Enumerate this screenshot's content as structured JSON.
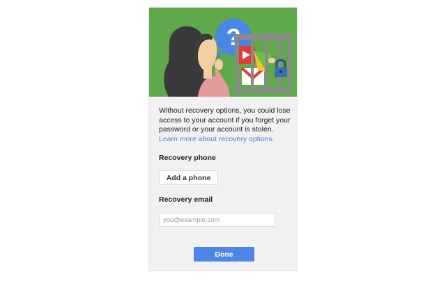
{
  "dialog": {
    "illustration": {
      "name": "recovery-illustration",
      "question_mark": "?",
      "colors": {
        "background": "#5fa84b",
        "bubble": "#4a86e8",
        "hair": "#3a3a3a",
        "skin": "#f4cfa6",
        "shirt": "#e39a9a",
        "cage": "#8a8a8a",
        "lock": "#3d6bb4"
      }
    },
    "description": "Without recovery options, you could lose access to your account if you forget your password or your account is stolen.",
    "learn_more_link": "Learn more about recovery options.",
    "recovery_phone": {
      "label": "Recovery phone",
      "add_button": "Add a phone"
    },
    "recovery_email": {
      "label": "Recovery email",
      "placeholder": "you@example.com",
      "value": ""
    },
    "done_button": "Done",
    "colors": {
      "primary_button": "#4c86e9",
      "link": "#4a7fd6",
      "card_background": "#f1f1f1"
    }
  }
}
